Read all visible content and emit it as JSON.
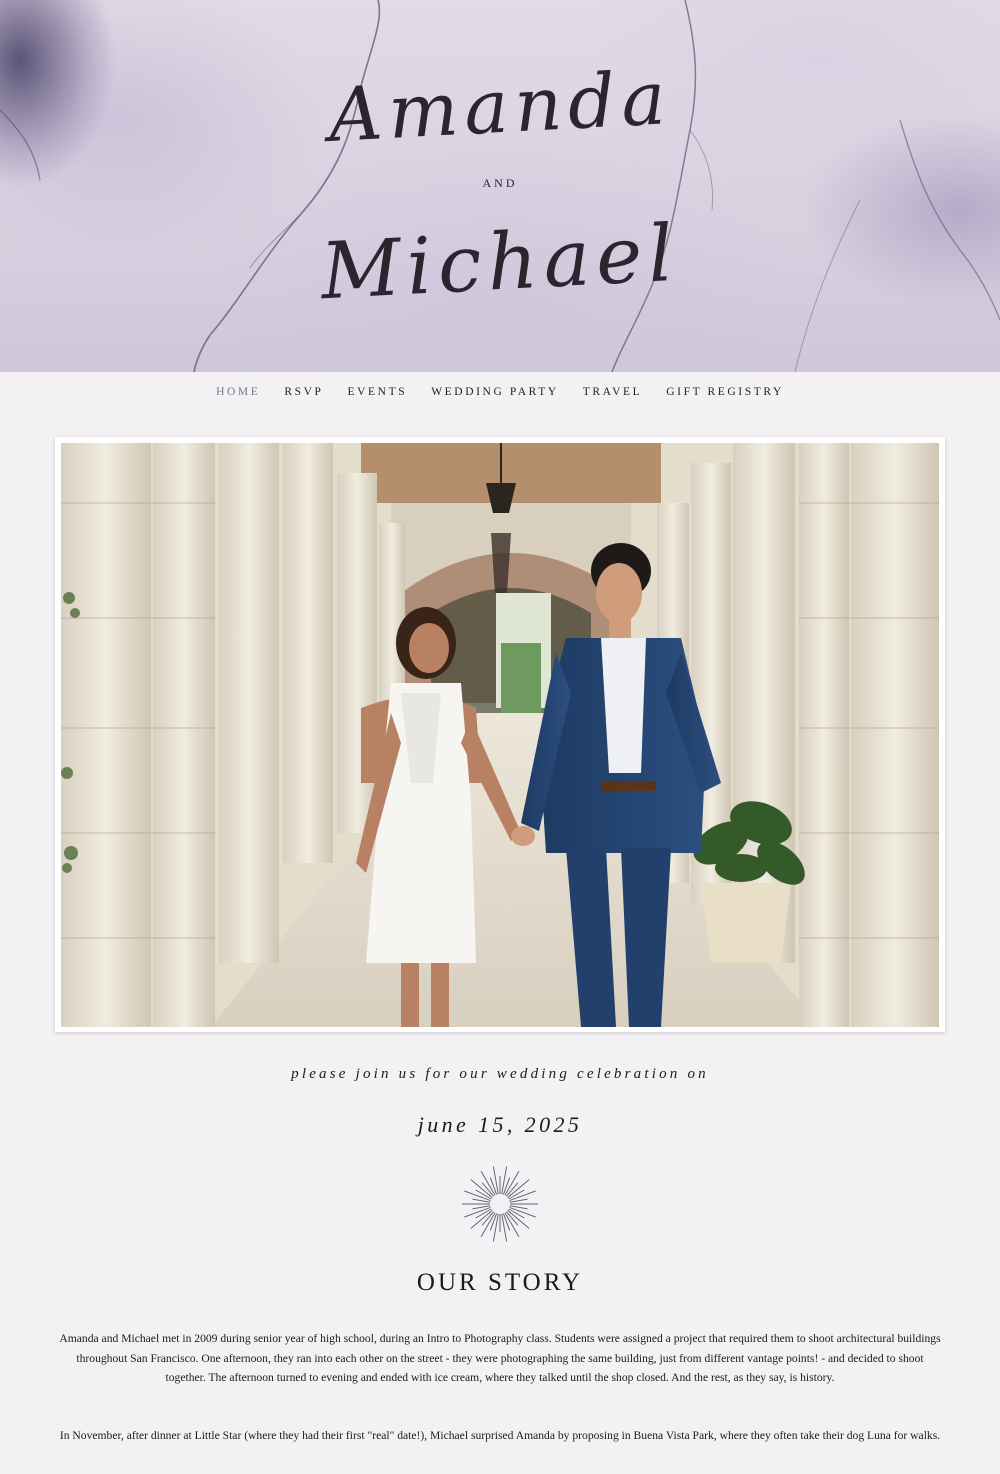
{
  "hero": {
    "name_one": "Amanda",
    "and_word": "AND",
    "name_two": "Michael"
  },
  "nav": {
    "items": [
      {
        "label": "HOME",
        "active": true
      },
      {
        "label": "RSVP",
        "active": false
      },
      {
        "label": "EVENTS",
        "active": false
      },
      {
        "label": "WEDDING PARTY",
        "active": false
      },
      {
        "label": "TRAVEL",
        "active": false
      },
      {
        "label": "GIFT REGISTRY",
        "active": false
      }
    ]
  },
  "invitation": {
    "line": "please join us for our wedding celebration on",
    "date": "june 15, 2025"
  },
  "story": {
    "title": "OUR STORY",
    "paragraph_one": "Amanda and Michael met in 2009 during senior year of high school, during an Intro to Photography class. Students were assigned a project that required them to shoot architectural buildings throughout San Francisco. One afternoon, they ran into each other on the street - they were photographing the same building, just from different vantage points! - and decided to shoot together. The afternoon turned to evening and ended with ice cream, where they talked until the shop closed. And the rest, as they say, is history.",
    "paragraph_two": "In November, after dinner at Little Star (where they had their first \"real\" date!), Michael surprised Amanda by proposing in Buena Vista Park, where they often take their dog Luna for walks."
  },
  "colors": {
    "page_background": "#f3f1f4",
    "marble_base": "#d8d1e0",
    "marble_vein": "#5b5475",
    "text": "#1b1b1b",
    "nav_active": "#7b7580"
  }
}
